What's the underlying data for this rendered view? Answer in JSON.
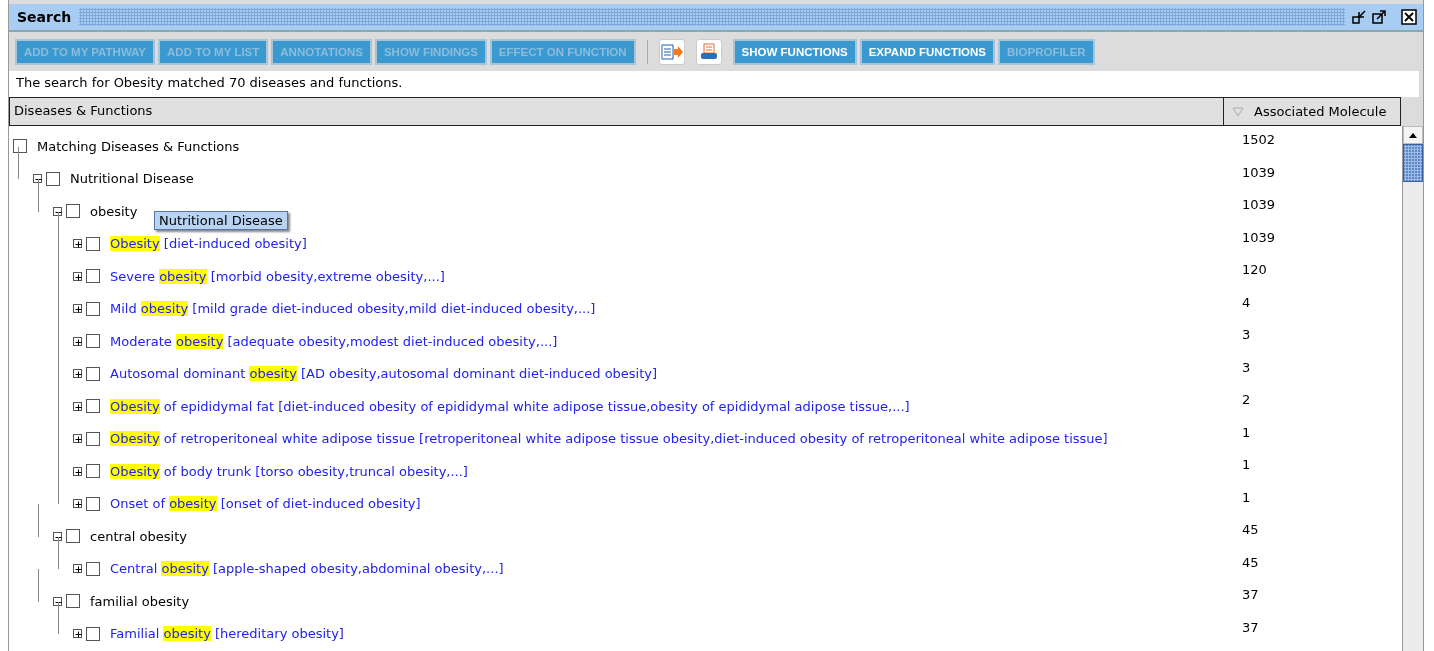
{
  "window": {
    "title": "Search"
  },
  "toolbar": {
    "buttons": [
      {
        "label": "ADD TO MY PATHWAY",
        "disabled": true
      },
      {
        "label": "ADD TO MY LIST",
        "disabled": true
      },
      {
        "label": "ANNOTATIONS",
        "disabled": true
      },
      {
        "label": "SHOW FINDINGS",
        "disabled": true
      },
      {
        "label": "EFFECT ON FUNCTION",
        "disabled": true
      },
      {
        "kind": "export"
      },
      {
        "kind": "print"
      },
      {
        "label": "SHOW FUNCTIONS",
        "disabled": false
      },
      {
        "label": "EXPAND FUNCTIONS",
        "disabled": false
      },
      {
        "label": "BIOPROFILER",
        "disabled": true
      }
    ]
  },
  "message": "The search for Obesity matched 70 diseases and functions.",
  "table": {
    "columns": [
      "Diseases & Functions",
      "Associated Molecule"
    ],
    "rows": [
      {
        "kind": "group",
        "prefix": "Matching Diseases & Functions",
        "checked": false,
        "count": "1502",
        "children": [
          {
            "kind": "group",
            "prefix": "Nutritional Disease",
            "expanded": true,
            "checked": false,
            "count": "1039",
            "children": [
              {
                "kind": "group",
                "prefix": "obesity",
                "expanded": true,
                "checked": false,
                "count": "1039",
                "children": [
                  {
                    "kind": "link",
                    "match": "Obesity",
                    "suffix": " [diet-induced obesity]",
                    "expanded": false,
                    "checked": false,
                    "count": "1039"
                  },
                  {
                    "kind": "link",
                    "prefix": "Severe ",
                    "match": "obesity",
                    "suffix": " [morbid obesity,extreme obesity,...]",
                    "expanded": false,
                    "checked": false,
                    "count": "120"
                  },
                  {
                    "kind": "link",
                    "prefix": "Mild ",
                    "match": "obesity",
                    "suffix": " [mild grade diet-induced obesity,mild diet-induced obesity,...]",
                    "expanded": false,
                    "checked": false,
                    "count": "4"
                  },
                  {
                    "kind": "link",
                    "prefix": "Moderate ",
                    "match": "obesity",
                    "suffix": " [adequate obesity,modest diet-induced obesity,...]",
                    "expanded": false,
                    "checked": false,
                    "count": "3"
                  },
                  {
                    "kind": "link",
                    "prefix": "Autosomal dominant ",
                    "match": "obesity",
                    "suffix": " [AD obesity,autosomal dominant diet-induced obesity]",
                    "expanded": false,
                    "checked": false,
                    "count": "3"
                  },
                  {
                    "kind": "link",
                    "match": "Obesity",
                    "suffix": " of epididymal fat [diet-induced obesity of epididymal white adipose tissue,obesity of epididymal adipose tissue,...]",
                    "expanded": false,
                    "checked": false,
                    "count": "2"
                  },
                  {
                    "kind": "link",
                    "match": "Obesity",
                    "suffix": " of retroperitoneal white adipose tissue [retroperitoneal white adipose tissue obesity,diet-induced obesity of retroperitoneal white adipose tissue]",
                    "expanded": false,
                    "checked": false,
                    "count": "1"
                  },
                  {
                    "kind": "link",
                    "match": "Obesity",
                    "suffix": " of body trunk [torso obesity,truncal obesity,...]",
                    "expanded": false,
                    "checked": false,
                    "count": "1"
                  },
                  {
                    "kind": "link",
                    "prefix": "Onset of ",
                    "match": "obesity",
                    "suffix": " [onset of diet-induced obesity]",
                    "expanded": false,
                    "checked": false,
                    "count": "1"
                  }
                ]
              },
              {
                "kind": "group",
                "prefix": "central obesity",
                "expanded": true,
                "checked": false,
                "count": "45",
                "children": [
                  {
                    "kind": "link",
                    "prefix": "Central ",
                    "match": "obesity",
                    "suffix": " [apple-shaped obesity,abdominal obesity,...]",
                    "expanded": false,
                    "checked": false,
                    "count": "45"
                  }
                ]
              },
              {
                "kind": "group",
                "prefix": "familial obesity",
                "expanded": true,
                "checked": false,
                "count": "37",
                "children": [
                  {
                    "kind": "link",
                    "prefix": "Familial ",
                    "match": "obesity",
                    "suffix": " [hereditary obesity]",
                    "expanded": false,
                    "checked": false,
                    "count": "37"
                  }
                ]
              }
            ]
          }
        ]
      }
    ]
  },
  "tooltip": "Nutritional Disease"
}
